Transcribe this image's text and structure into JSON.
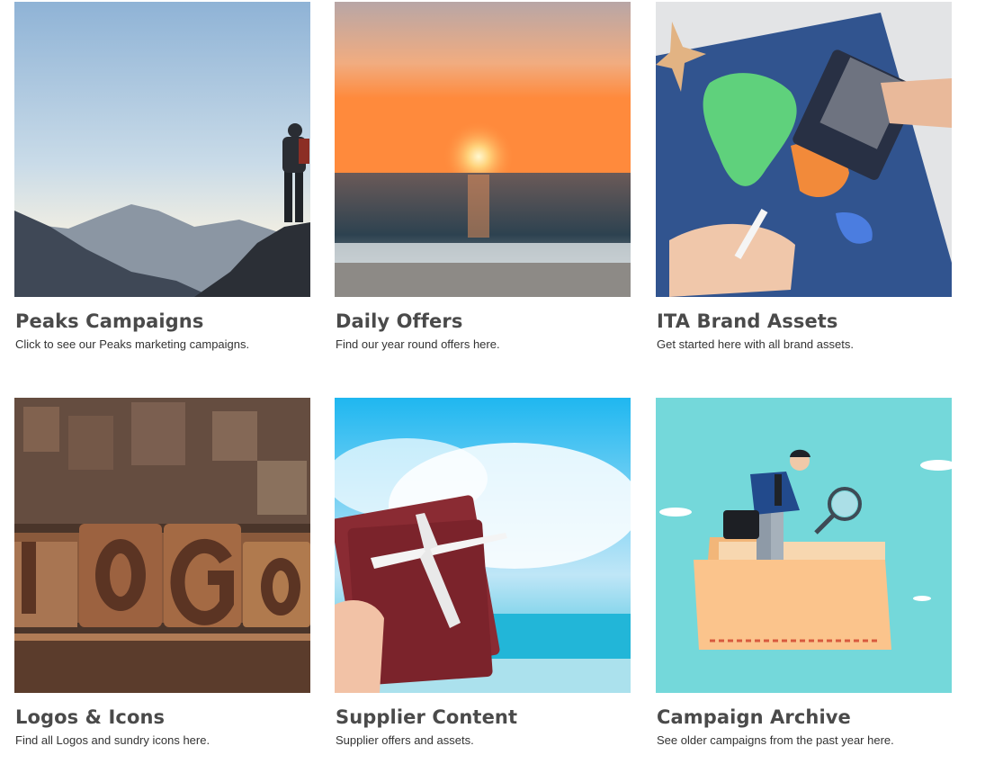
{
  "cards": [
    {
      "title": "Peaks Campaigns",
      "description": "Click to see our Peaks marketing campaigns.",
      "image": "mountain-hiker-photo"
    },
    {
      "title": "Daily Offers",
      "description": "Find our year round offers here.",
      "image": "ocean-sunset-photo"
    },
    {
      "title": "ITA Brand Assets",
      "description": "Get started here with all brand assets.",
      "image": "map-passport-photo"
    },
    {
      "title": "Logos & Icons",
      "description": "Find all Logos and sundry icons here.",
      "image": "wooden-logo-letters-photo"
    },
    {
      "title": "Supplier Content",
      "description": "Supplier offers and assets.",
      "image": "passport-airplane-photo"
    },
    {
      "title": "Campaign Archive",
      "description": "See older campaigns from the past year here.",
      "image": "archive-folder-illustration"
    }
  ]
}
